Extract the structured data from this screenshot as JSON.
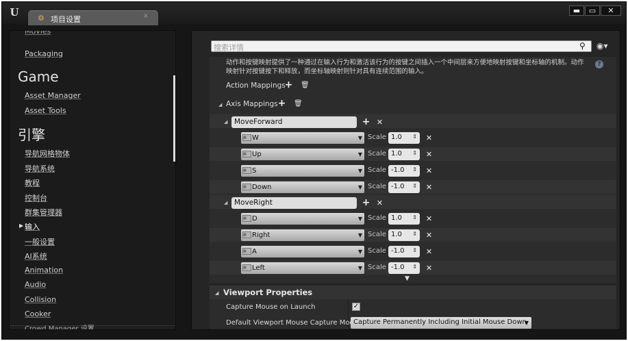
{
  "window": {
    "tab_label": "项目设置",
    "tab_close": "×",
    "minimize": "▬",
    "maximize": "▭",
    "close": "✕",
    "logo": "U"
  },
  "sidebar": {
    "cut_top": "Movies",
    "packaging": "Packaging",
    "game_header": "Game",
    "asset_manager": "Asset Manager",
    "asset_tools": "Asset Tools",
    "engine_header": "引擎",
    "items": [
      "导航网格物体",
      "导航系统",
      "教程",
      "控制台",
      "群集管理器",
      "输入",
      "一般设置",
      "AI系统",
      "Animation",
      "Audio",
      "Collision",
      "Cooker"
    ],
    "selected_arrow": "▶",
    "cut_bottom": "Crowd Manager 设置"
  },
  "search": {
    "placeholder": "搜索详情",
    "icon": "search-icon"
  },
  "description": "动作和按键映射提供了一种通过在输入行为和激活该行为的按键之间插入一个中间层来方便地映射按键和坐标轴的机制。动作映射针对按键按下和释放，而坐标轴映射则针对具有连续范围的输入。",
  "action_mappings": "Action Mappings",
  "axis_mappings": "Axis Mappings",
  "scale_label": "Scale",
  "axis_groups": [
    {
      "name": "MoveForward",
      "keys": [
        {
          "key": "W",
          "scale": "1.0"
        },
        {
          "key": "Up",
          "scale": "1.0"
        },
        {
          "key": "S",
          "scale": "-1.0"
        },
        {
          "key": "Down",
          "scale": "-1.0"
        }
      ]
    },
    {
      "name": "MoveRight",
      "keys": [
        {
          "key": "D",
          "scale": "1.0"
        },
        {
          "key": "Right",
          "scale": "1.0"
        },
        {
          "key": "A",
          "scale": "-1.0"
        },
        {
          "key": "Left",
          "scale": "-1.0"
        }
      ]
    }
  ],
  "viewport": {
    "title": "Viewport Properties",
    "capture_mouse_label": "Capture Mouse on Launch",
    "capture_mouse_checked": true,
    "default_capture_label": "Default Viewport Mouse Capture Mod",
    "default_capture_value": "Capture Permanently Including Initial Mouse Down"
  },
  "colors": {
    "background": "#161616",
    "panel": "#2c2c2c",
    "accent": "#f0f0f0"
  }
}
